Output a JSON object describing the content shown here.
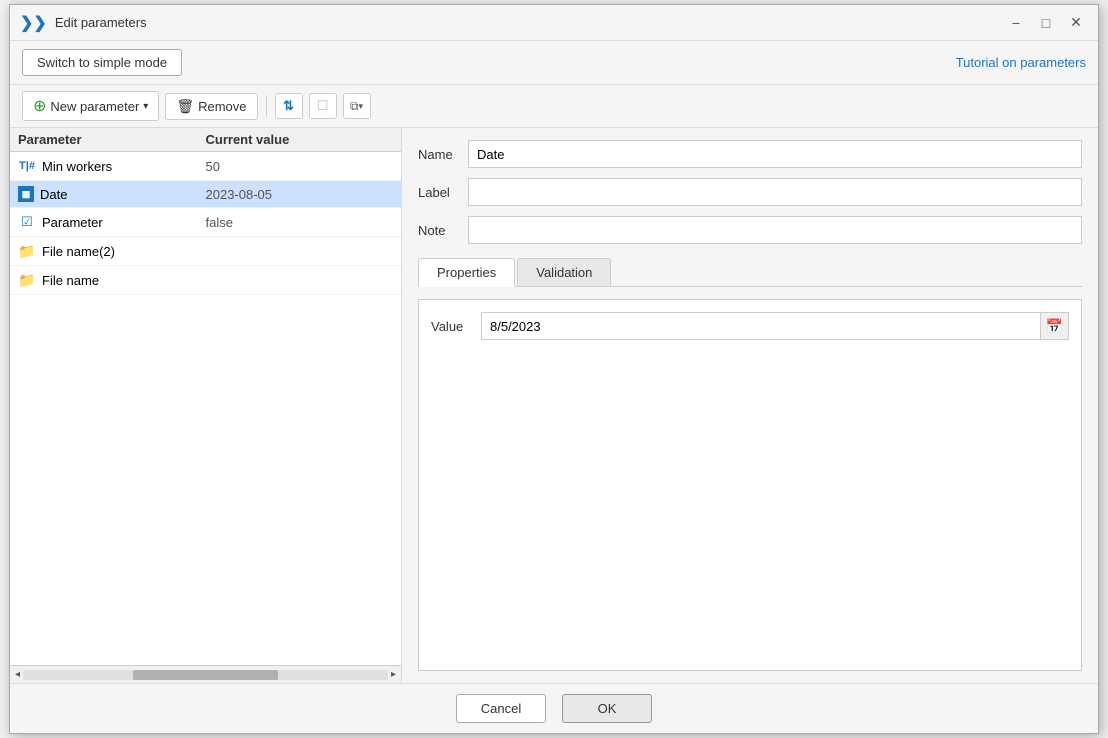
{
  "titlebar": {
    "icon": "❯❯",
    "title": "Edit parameters",
    "minimize_label": "−",
    "maximize_label": "□",
    "close_label": "✕"
  },
  "top_toolbar": {
    "switch_btn_label": "Switch to simple mode",
    "tutorial_link_label": "Tutorial on parameters"
  },
  "action_toolbar": {
    "new_param_label": "New parameter",
    "remove_label": "Remove",
    "sort_icon": "↑↓",
    "copy_icon": "⧉",
    "paste_icon": "⧉▾",
    "clear_icon": "☐"
  },
  "param_table": {
    "col_param": "Parameter",
    "col_value": "Current value"
  },
  "params": [
    {
      "id": 1,
      "icon_type": "integer",
      "name": "Min workers",
      "value": "50"
    },
    {
      "id": 2,
      "icon_type": "date",
      "name": "Date",
      "value": "2023-08-05",
      "selected": true
    },
    {
      "id": 3,
      "icon_type": "bool",
      "name": "Parameter",
      "value": "false"
    },
    {
      "id": 4,
      "icon_type": "folder",
      "name": "File name(2)",
      "value": ""
    },
    {
      "id": 5,
      "icon_type": "folder",
      "name": "File name",
      "value": ""
    }
  ],
  "right_panel": {
    "name_label": "Name",
    "name_value": "Date",
    "label_label": "Label",
    "label_value": "",
    "note_label": "Note",
    "note_value": "",
    "tab_properties": "Properties",
    "tab_validation": "Validation",
    "value_label": "Value",
    "value_value": "8/5/2023",
    "calendar_icon": "📅"
  },
  "bottom": {
    "cancel_label": "Cancel",
    "ok_label": "OK"
  }
}
